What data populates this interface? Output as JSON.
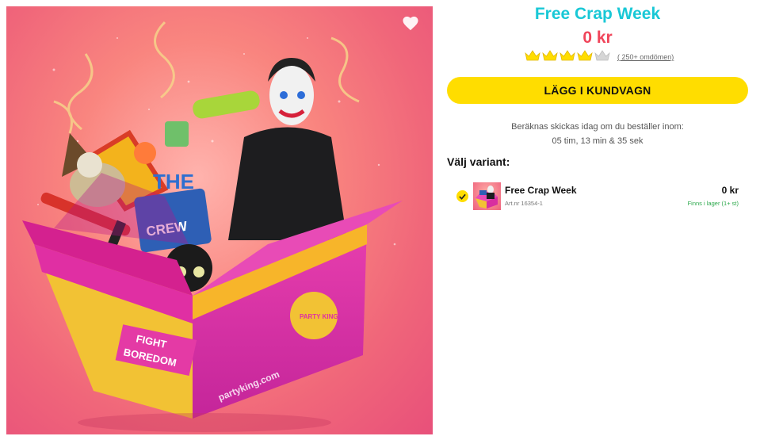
{
  "product": {
    "title": "Free Crap Week",
    "price": "0 kr",
    "rating": {
      "value": 4,
      "max": 5,
      "reviews_label": "( 250+ omdömen)"
    },
    "image": {
      "box_text_fight": "FIGHT",
      "box_text_boredom": "BOREDOM",
      "box_url": "partyking.com",
      "crew_text": "CREW",
      "sign_text": "THE",
      "logo_text": "PARTY KING"
    }
  },
  "cart": {
    "button_label": "LÄGG I KUNDVAGN"
  },
  "shipping": {
    "line1": "Beräknas skickas idag om du beställer inom:",
    "line2": "05 tim,  13 min &  35 sek"
  },
  "variants": {
    "heading": "Välj variant:",
    "items": [
      {
        "name": "Free Crap Week",
        "art_nr": "Art.nr 16354-1",
        "price": "0 kr",
        "stock": "Finns i lager (1+ st)"
      }
    ]
  },
  "colors": {
    "title": "#19c8d6",
    "price": "#f0455a",
    "accent": "#ffdd00",
    "stock": "#2aa84a"
  },
  "icons": {
    "favorite": "heart-icon",
    "rating": "crown-icon",
    "selected": "check-icon"
  }
}
